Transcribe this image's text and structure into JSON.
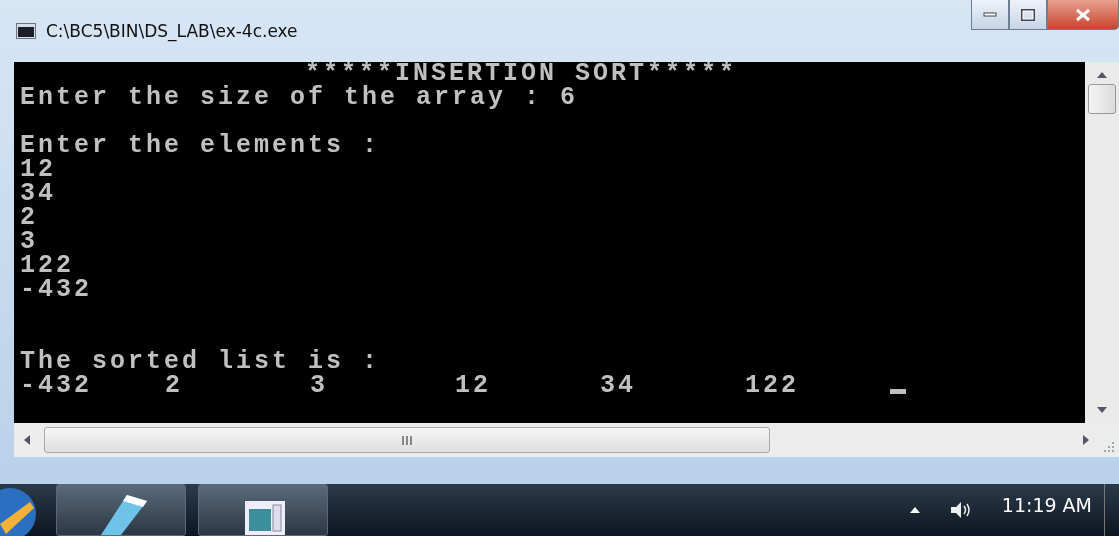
{
  "window": {
    "title": "C:\\BC5\\BIN\\DS_LAB\\ex-4c.exe"
  },
  "console": {
    "lines": [
      {
        "kind": "heading",
        "text": "*****INSERTION SORT*****"
      },
      {
        "kind": "text",
        "text": "Enter the size of the array : 6"
      },
      {
        "kind": "blank"
      },
      {
        "kind": "text",
        "text": "Enter the elements :"
      },
      {
        "kind": "text",
        "text": "12"
      },
      {
        "kind": "text",
        "text": "34"
      },
      {
        "kind": "text",
        "text": "2"
      },
      {
        "kind": "text",
        "text": "3"
      },
      {
        "kind": "text",
        "text": "122"
      },
      {
        "kind": "text",
        "text": "-432"
      },
      {
        "kind": "blank"
      },
      {
        "kind": "blank"
      },
      {
        "kind": "text",
        "text": "The sorted list is :"
      },
      {
        "kind": "values",
        "values": [
          "-432",
          "2",
          "3",
          "12",
          "34",
          "122"
        ]
      }
    ],
    "cursor": true
  },
  "taskbar": {
    "clock": "11:19 AM"
  }
}
